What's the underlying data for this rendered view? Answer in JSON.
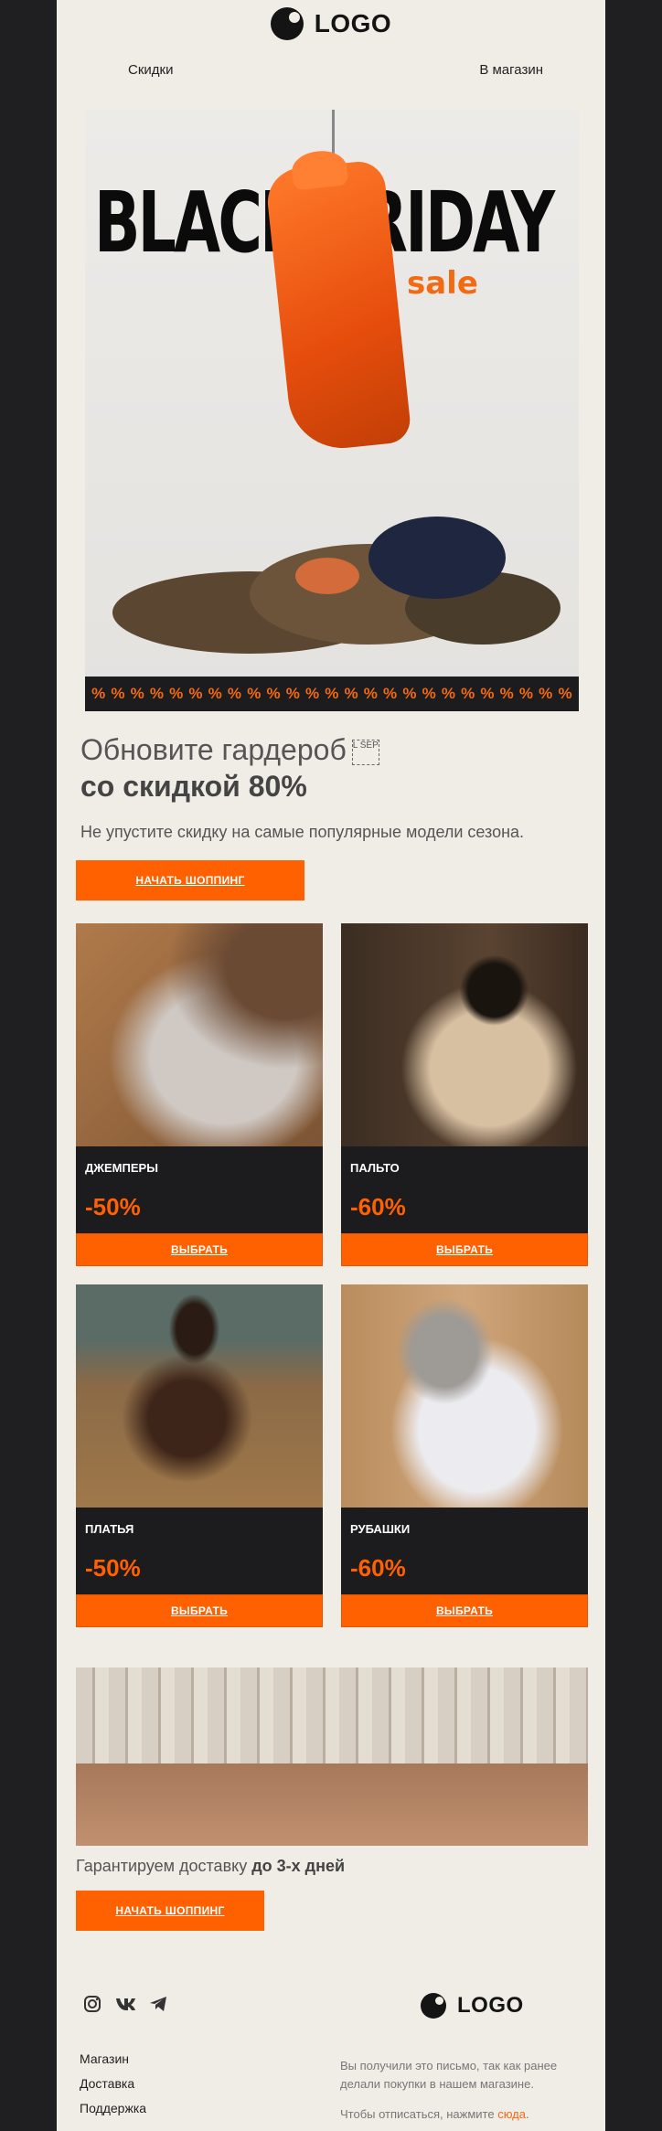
{
  "header": {
    "logo_text": "LOGO"
  },
  "nav": {
    "discounts": "Скидки",
    "to_store": "В магазин"
  },
  "hero": {
    "title": "BLACK FRIDAY",
    "subtitle": "sale",
    "percent_symbol": "%"
  },
  "intro": {
    "line1": "Обновите гардероб",
    "sep_marker": "L SEP",
    "line2": "со скидкой 80%",
    "text": "Не упустите скидку на самые популярные модели сезона.",
    "button": "НАЧАТЬ ШОППИНГ"
  },
  "cards": [
    {
      "category": "ДЖЕМПЕРЫ",
      "discount": "-50%",
      "button": "ВЫБРАТЬ"
    },
    {
      "category": "ПАЛЬТО",
      "discount": "-60%",
      "button": "ВЫБРАТЬ"
    },
    {
      "category": "ПЛАТЬЯ",
      "discount": "-50%",
      "button": "ВЫБРАТЬ"
    },
    {
      "category": "РУБАШКИ",
      "discount": "-60%",
      "button": "ВЫБРАТЬ"
    }
  ],
  "delivery": {
    "text": "Гарантируем доставку ",
    "bold": "до 3-х дней",
    "button": "НАЧАТЬ ШОППИНГ"
  },
  "footer": {
    "logo_text": "LOGO",
    "social": [
      "instagram-icon",
      "vk-icon",
      "telegram-icon"
    ],
    "links": [
      "Магазин",
      "Доставка",
      "Поддержка"
    ],
    "notice": "Вы получили это письмо, так как ранее делали покупки в нашем магазине.",
    "unsubscribe_text": "Чтобы отписаться, нажмите ",
    "unsubscribe_link": "сюда",
    "unsubscribe_end": "."
  },
  "colors": {
    "accent": "#ff6000",
    "dark": "#1c1b1e",
    "background": "#f0ece6"
  }
}
